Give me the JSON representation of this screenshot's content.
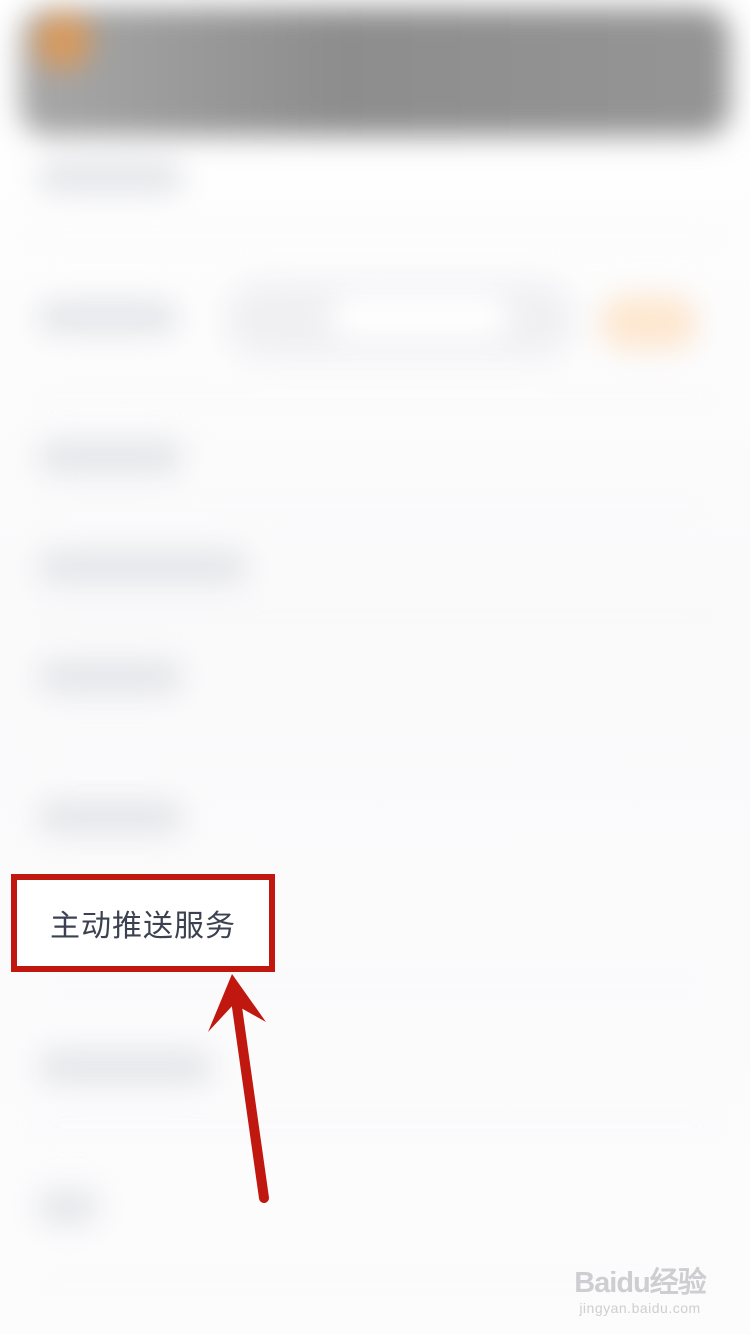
{
  "highlighted_item": {
    "label": "主动推送服务"
  },
  "annotation": {
    "box_color": "#c0180e",
    "arrow_color": "#c0180e"
  },
  "watermark": {
    "brand": "Baidu经验",
    "url": "jingyan.baidu.com"
  }
}
